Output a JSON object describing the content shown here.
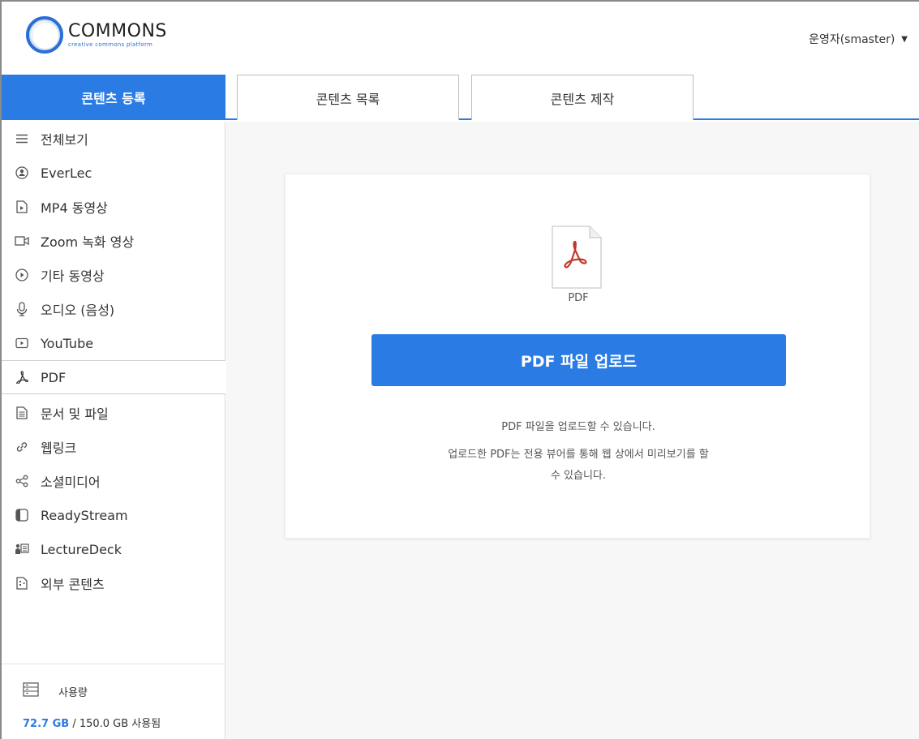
{
  "header": {
    "logo_title": "COMMONS",
    "logo_subtitle": "creative commons platform",
    "user_label": "운영자(smaster)"
  },
  "tabs": {
    "register": "콘텐츠 등록",
    "list": "콘텐츠 목록",
    "produce": "콘텐츠 제작"
  },
  "sidebar": {
    "items": [
      {
        "label": "전체보기",
        "icon": "menu-icon"
      },
      {
        "label": "EverLec",
        "icon": "everlec-icon"
      },
      {
        "label": "MP4 동영상",
        "icon": "video-file-icon"
      },
      {
        "label": "Zoom 녹화 영상",
        "icon": "camera-icon"
      },
      {
        "label": "기타 동영상",
        "icon": "play-circle-icon"
      },
      {
        "label": "오디오 (음성)",
        "icon": "microphone-icon"
      },
      {
        "label": "YouTube",
        "icon": "youtube-icon"
      },
      {
        "label": "PDF",
        "icon": "pdf-icon"
      },
      {
        "label": "문서 및 파일",
        "icon": "document-icon"
      },
      {
        "label": "웹링크",
        "icon": "link-icon"
      },
      {
        "label": "소셜미디어",
        "icon": "share-icon"
      },
      {
        "label": "ReadyStream",
        "icon": "readystream-icon"
      },
      {
        "label": "LectureDeck",
        "icon": "lecturedeck-icon"
      },
      {
        "label": "외부 콘텐츠",
        "icon": "external-content-icon"
      }
    ],
    "usage": {
      "label": "사용량",
      "used": "72.7 GB",
      "rest": " / 150.0 GB 사용됨"
    }
  },
  "main": {
    "file_caption": "PDF",
    "upload_button": "PDF 파일 업로드",
    "desc_line1": "PDF 파일을 업로드할 수 있습니다.",
    "desc_line2": "업로드한 PDF는 전용 뷰어를 통해 웹 상에서 미리보기를 할",
    "desc_line3": "수 있습니다."
  },
  "colors": {
    "accent": "#2a7be4",
    "pdf_red": "#c0392b"
  }
}
